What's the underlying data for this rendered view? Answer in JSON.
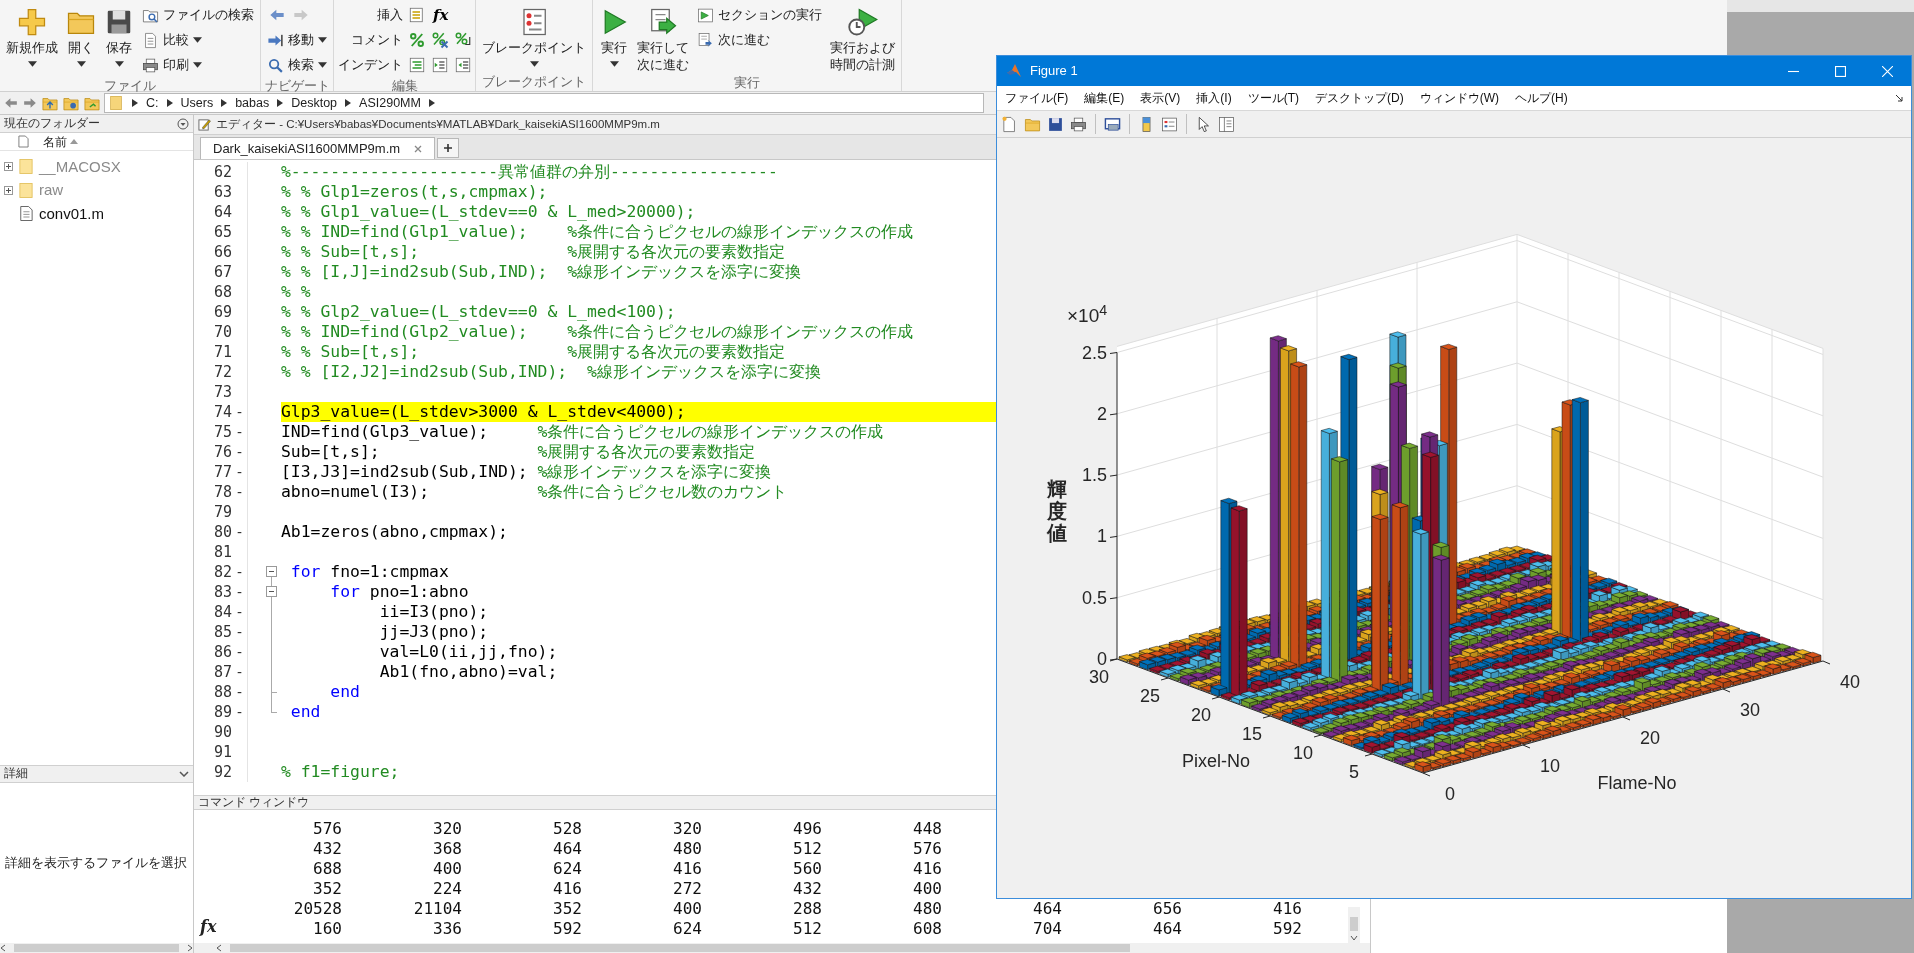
{
  "toolstrip": {
    "groups": [
      {
        "label": "ファイル",
        "columns": [
          [
            {
              "kind": "large",
              "lines": [
                "新規作成"
              ],
              "dropdown": true
            }
          ],
          [
            {
              "kind": "large",
              "lines": [
                "開く"
              ],
              "dropdown": true
            }
          ],
          [
            {
              "kind": "large",
              "lines": [
                "保存"
              ],
              "dropdown": true
            }
          ],
          [
            {
              "kind": "small",
              "label": "ファイルの検索",
              "dropdown": false
            },
            {
              "kind": "small",
              "label": "比較",
              "dropdown": true
            },
            {
              "kind": "small",
              "label": "印刷",
              "dropdown": true
            }
          ]
        ]
      },
      {
        "label": "ナビゲート",
        "columns": [
          [
            {
              "kind": "nav",
              "back_enabled": true,
              "forward_enabled": false
            },
            {
              "kind": "small",
              "label": "移動",
              "dropdown": true
            },
            {
              "kind": "small",
              "label": "検索",
              "dropdown": true
            }
          ]
        ]
      },
      {
        "label": "編集",
        "columns": [
          [
            {
              "kind": "tools",
              "label": "挿入",
              "extra": "fx"
            },
            {
              "kind": "tools",
              "label": "コメント"
            },
            {
              "kind": "tools",
              "label": "インデント"
            }
          ]
        ]
      },
      {
        "label": "ブレークポイント",
        "columns": [
          [
            {
              "kind": "large",
              "lines": [
                "ブレークポイント"
              ],
              "dropdown": true
            }
          ]
        ]
      },
      {
        "label": "実行",
        "columns": [
          [
            {
              "kind": "large",
              "lines": [
                "実行"
              ],
              "dropdown": true
            }
          ],
          [
            {
              "kind": "large",
              "lines": [
                "実行して",
                "次に進む"
              ],
              "dropdown": false
            }
          ],
          [
            {
              "kind": "small",
              "label": "セクションの実行",
              "dropdown": false
            },
            {
              "kind": "small",
              "label": "次に進む",
              "dropdown": false
            }
          ],
          [
            {
              "kind": "large",
              "lines": [
                "実行および",
                "時間の計測"
              ],
              "dropdown": false
            }
          ]
        ]
      }
    ]
  },
  "address_bar": {
    "path": [
      "C:",
      "Users",
      "babas",
      "Desktop",
      "ASI290MM"
    ]
  },
  "current_folder": {
    "title": "現在のフォルダー",
    "column": "名前",
    "items": [
      {
        "name": "__MACOSX",
        "kind": "folder",
        "expandable": true,
        "dimmed": true
      },
      {
        "name": "raw",
        "kind": "folder",
        "expandable": true,
        "dimmed": true
      },
      {
        "name": "conv01.m",
        "kind": "file",
        "expandable": false,
        "dimmed": false
      }
    ]
  },
  "details": {
    "title": "詳細",
    "message": "詳細を表示するファイルを選択"
  },
  "editor": {
    "title": "エディター - C:¥Users¥babas¥Documents¥MATLAB¥Dark_kaisekiASI1600MMP9m.m",
    "tabs": [
      {
        "label": "Dark_kaisekiASI1600MMP9m.m",
        "selected": true
      }
    ],
    "lines": [
      {
        "number": "62",
        "highlighted": false,
        "segments": [
          {
            "kind": "comment",
            "text": "%---------------------異常値群の弁別-----------------"
          }
        ]
      },
      {
        "number": "63",
        "highlighted": false,
        "segments": [
          {
            "kind": "comment",
            "text": "% % Glp1=zeros(t,s,cmpmax);"
          }
        ]
      },
      {
        "number": "64",
        "highlighted": false,
        "segments": [
          {
            "kind": "comment",
            "text": "% % Glp1_value=(L_stdev==0 & L_med>20000);"
          }
        ]
      },
      {
        "number": "65",
        "highlighted": false,
        "segments": [
          {
            "kind": "comment",
            "text": "% % IND=find(Glp1_value);    %条件に合うピクセルの線形インデックスの作成"
          }
        ]
      },
      {
        "number": "66",
        "highlighted": false,
        "segments": [
          {
            "kind": "comment",
            "text": "% % Sub=[t,s];               %展開する各次元の要素数指定"
          }
        ]
      },
      {
        "number": "67",
        "highlighted": false,
        "segments": [
          {
            "kind": "comment",
            "text": "% % [I,J]=ind2sub(Sub,IND);  %線形インデックスを添字に変換"
          }
        ]
      },
      {
        "number": "68",
        "highlighted": false,
        "segments": [
          {
            "kind": "comment",
            "text": "% %"
          }
        ]
      },
      {
        "number": "69",
        "highlighted": false,
        "segments": [
          {
            "kind": "comment",
            "text": "% % Glp2_value=(L_stdev==0 & L_med<100);"
          }
        ]
      },
      {
        "number": "70",
        "highlighted": false,
        "segments": [
          {
            "kind": "comment",
            "text": "% % IND=find(Glp2_value);    %条件に合うピクセルの線形インデックスの作成"
          }
        ]
      },
      {
        "number": "71",
        "highlighted": false,
        "segments": [
          {
            "kind": "comment",
            "text": "% % Sub=[t,s];               %展開する各次元の要素数指定"
          }
        ]
      },
      {
        "number": "72",
        "highlighted": false,
        "segments": [
          {
            "kind": "comment",
            "text": "% % [I2,J2]=ind2sub(Sub,IND);  %線形インデックスを添字に変換"
          }
        ]
      },
      {
        "number": "73",
        "highlighted": false
      },
      {
        "number": "74",
        "marker": "-",
        "highlighted": true,
        "segments": [
          {
            "kind": "code",
            "text": "Glp3_value=(L_stdev>3000 & L_stdev<4000);"
          }
        ]
      },
      {
        "number": "75",
        "marker": "-",
        "highlighted": false,
        "segments": [
          {
            "kind": "code",
            "text": "IND=find(Glp3_value);     "
          },
          {
            "kind": "comment",
            "text": "%条件に合うピクセルの線形インデックスの作成"
          }
        ]
      },
      {
        "number": "76",
        "marker": "-",
        "highlighted": false,
        "segments": [
          {
            "kind": "code",
            "text": "Sub=[t,s];                "
          },
          {
            "kind": "comment",
            "text": "%展開する各次元の要素数指定"
          }
        ]
      },
      {
        "number": "77",
        "marker": "-",
        "highlighted": false,
        "segments": [
          {
            "kind": "code",
            "text": "[I3,J3]=ind2sub(Sub,IND); "
          },
          {
            "kind": "comment",
            "text": "%線形インデックスを添字に変換"
          }
        ]
      },
      {
        "number": "78",
        "marker": "-",
        "highlighted": false,
        "segments": [
          {
            "kind": "code",
            "text": "abno=numel(I3);           "
          },
          {
            "kind": "comment",
            "text": "%条件に合うピクセル数のカウント"
          }
        ]
      },
      {
        "number": "79",
        "highlighted": false
      },
      {
        "number": "80",
        "marker": "-",
        "highlighted": false,
        "segments": [
          {
            "kind": "code",
            "text": "Ab1=zeros(abno,cmpmax);"
          }
        ]
      },
      {
        "number": "81",
        "highlighted": false
      },
      {
        "number": "82",
        "marker": "-",
        "highlighted": false,
        "kind": "fold_start",
        "segments": [
          {
            "kind": "keyword",
            "text": " for"
          },
          {
            "kind": "code",
            "text": " fno=1:cmpmax"
          }
        ]
      },
      {
        "number": "83",
        "marker": "-",
        "highlighted": false,
        "kind": "fold_start",
        "segments": [
          {
            "kind": "keyword",
            "text": "     for"
          },
          {
            "kind": "code",
            "text": " pno=1:abno"
          }
        ]
      },
      {
        "number": "84",
        "marker": "-",
        "highlighted": false,
        "segments": [
          {
            "kind": "code",
            "text": "          ii=I3(pno);"
          }
        ]
      },
      {
        "number": "85",
        "marker": "-",
        "highlighted": false,
        "segments": [
          {
            "kind": "code",
            "text": "          jj=J3(pno);"
          }
        ]
      },
      {
        "number": "86",
        "marker": "-",
        "highlighted": false,
        "segments": [
          {
            "kind": "code",
            "text": "          val=L0(ii,jj,fno);"
          }
        ]
      },
      {
        "number": "87",
        "marker": "-",
        "highlighted": false,
        "segments": [
          {
            "kind": "code",
            "text": "          Ab1(fno,abno)=val;"
          }
        ]
      },
      {
        "number": "88",
        "marker": "-",
        "highlighted": false,
        "kind": "fold_end",
        "segments": [
          {
            "kind": "keyword",
            "text": "     end"
          }
        ]
      },
      {
        "number": "89",
        "marker": "-",
        "highlighted": false,
        "kind": "fold_end",
        "segments": [
          {
            "kind": "keyword",
            "text": " end"
          }
        ]
      },
      {
        "number": "90",
        "highlighted": false
      },
      {
        "number": "91",
        "highlighted": false
      },
      {
        "number": "92",
        "highlighted": false,
        "segments": [
          {
            "kind": "comment",
            "text": "% f1=figure;"
          }
        ]
      }
    ]
  },
  "command_window": {
    "title": "コマンド ウィンドウ",
    "prompt": "fx",
    "rows": [
      [
        "576",
        "320",
        "528",
        "320",
        "496",
        "448"
      ],
      [
        "432",
        "368",
        "464",
        "480",
        "512",
        "576"
      ],
      [
        "688",
        "400",
        "624",
        "416",
        "560",
        "416"
      ],
      [
        "352",
        "224",
        "416",
        "272",
        "432",
        "400"
      ],
      [
        "20528",
        "21104",
        "352",
        "400",
        "288",
        "480",
        "464",
        "656",
        "416"
      ],
      [
        "160",
        "336",
        "592",
        "624",
        "512",
        "608",
        "704",
        "464",
        "592"
      ]
    ]
  },
  "figure": {
    "title": "Figure 1",
    "menu": [
      "ファイル(F)",
      "編集(E)",
      "表示(V)",
      "挿入(I)",
      "ツール(T)",
      "デスクトップ(D)",
      "ウィンドウ(W)",
      "ヘルプ(H)"
    ],
    "plot": {
      "z_multiplier": "×10$^{4}$",
      "zlabel": "輝度値",
      "pixel_label": "Pixel-No",
      "flame_label": "Flame-No",
      "zticks": [
        "2.5",
        "2",
        "1.5",
        "1",
        "0.5",
        "0"
      ],
      "pixel_ticks": [
        "5",
        "10",
        "15",
        "20",
        "25",
        "30"
      ],
      "flame_ticks": [
        "0",
        "10",
        "20",
        "30",
        "40"
      ]
    }
  }
}
